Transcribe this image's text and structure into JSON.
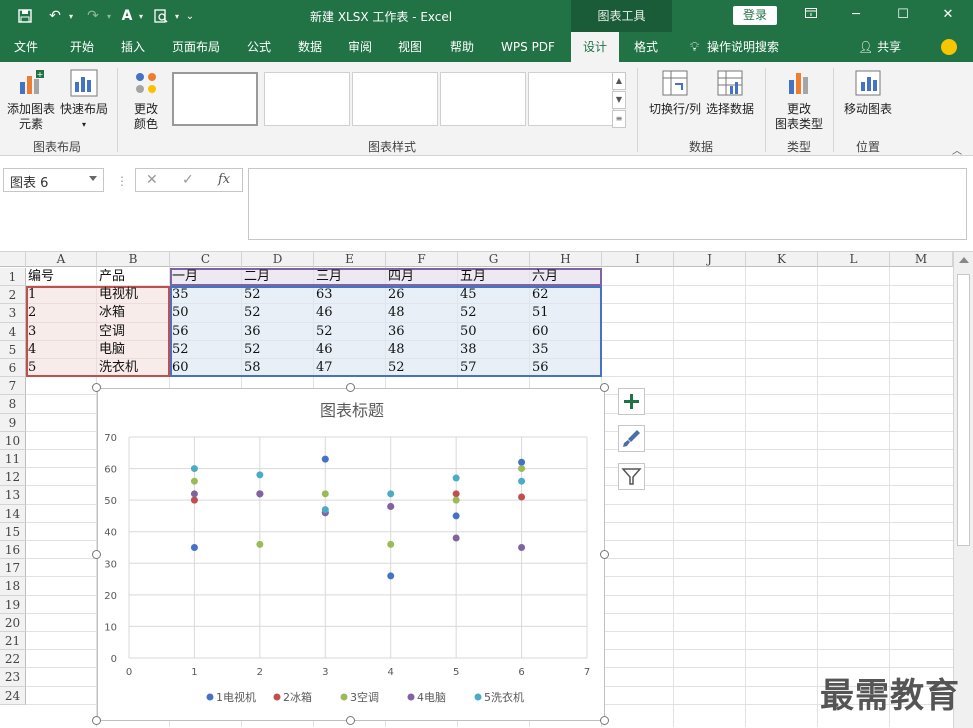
{
  "titlebar": {
    "title": "新建 XLSX 工作表  -  Excel",
    "context_tab": "图表工具",
    "login": "登录"
  },
  "tabs": [
    {
      "label": "文件"
    },
    {
      "label": "开始"
    },
    {
      "label": "插入"
    },
    {
      "label": "页面布局"
    },
    {
      "label": "公式"
    },
    {
      "label": "数据"
    },
    {
      "label": "审阅"
    },
    {
      "label": "视图"
    },
    {
      "label": "帮助"
    },
    {
      "label": "WPS PDF"
    },
    {
      "label": "设计"
    },
    {
      "label": "格式"
    }
  ],
  "tell_me": "操作说明搜索",
  "share": "共享",
  "ribbon": {
    "add_element": [
      "添加图表",
      "元素"
    ],
    "quick_layout": "快速布局",
    "change_color": [
      "更改",
      "颜色"
    ],
    "switch_row_col": "切换行/列",
    "select_data": "选择数据",
    "change_type": [
      "更改",
      "图表类型"
    ],
    "move_chart": "移动图表",
    "groups": {
      "layout": "图表布局",
      "styles": "图表样式",
      "data": "数据",
      "type": "类型",
      "location": "位置"
    }
  },
  "formula_bar": {
    "name_box": "图表 6",
    "fx": "fx",
    "cancel": "✕",
    "enter": "✓",
    "value": ""
  },
  "sheet": {
    "columns": [
      "A",
      "B",
      "C",
      "D",
      "E",
      "F",
      "G",
      "H",
      "I",
      "J",
      "K",
      "L",
      "M"
    ],
    "rows": [
      "1",
      "2",
      "3",
      "4",
      "5",
      "6",
      "7",
      "8",
      "9",
      "10",
      "11",
      "12",
      "13",
      "14",
      "15",
      "16",
      "17",
      "18",
      "19",
      "20",
      "21",
      "22",
      "23",
      "24"
    ],
    "table": {
      "header": [
        "编号",
        "产品",
        "一月",
        "二月",
        "三月",
        "四月",
        "五月",
        "六月"
      ],
      "rows": [
        [
          "1",
          "电视机",
          "35",
          "52",
          "63",
          "26",
          "45",
          "62"
        ],
        [
          "2",
          "冰箱",
          "50",
          "52",
          "46",
          "48",
          "52",
          "51"
        ],
        [
          "3",
          "空调",
          "56",
          "36",
          "52",
          "36",
          "50",
          "60"
        ],
        [
          "4",
          "电脑",
          "52",
          "52",
          "46",
          "48",
          "38",
          "35"
        ],
        [
          "5",
          "洗衣机",
          "60",
          "58",
          "47",
          "52",
          "57",
          "56"
        ]
      ]
    }
  },
  "chart_data": {
    "type": "scatter",
    "title": "图表标题",
    "xlim": [
      0,
      7
    ],
    "ylim": [
      0,
      70
    ],
    "xticks": [
      0,
      1,
      2,
      3,
      4,
      5,
      6,
      7
    ],
    "yticks": [
      0,
      10,
      20,
      30,
      40,
      50,
      60,
      70
    ],
    "grid": true,
    "legend_position": "bottom",
    "x": [
      1,
      2,
      3,
      4,
      5,
      6
    ],
    "series": [
      {
        "name": "1电视机",
        "color": "#4472c4",
        "values": [
          35,
          52,
          63,
          26,
          45,
          62
        ]
      },
      {
        "name": "2冰箱",
        "color": "#c0504d",
        "values": [
          50,
          52,
          46,
          48,
          52,
          51
        ]
      },
      {
        "name": "3空调",
        "color": "#9bbb59",
        "values": [
          56,
          36,
          52,
          36,
          50,
          60
        ]
      },
      {
        "name": "4电脑",
        "color": "#8064a2",
        "values": [
          52,
          52,
          46,
          48,
          38,
          35
        ]
      },
      {
        "name": "5洗衣机",
        "color": "#4bacc6",
        "values": [
          60,
          58,
          47,
          52,
          57,
          56
        ]
      }
    ]
  },
  "colors": {
    "excel_green": "#217346",
    "range_red": "#c0504d",
    "range_purple": "#8064a2",
    "range_blue": "#4472c4"
  },
  "watermark": "最需教育"
}
